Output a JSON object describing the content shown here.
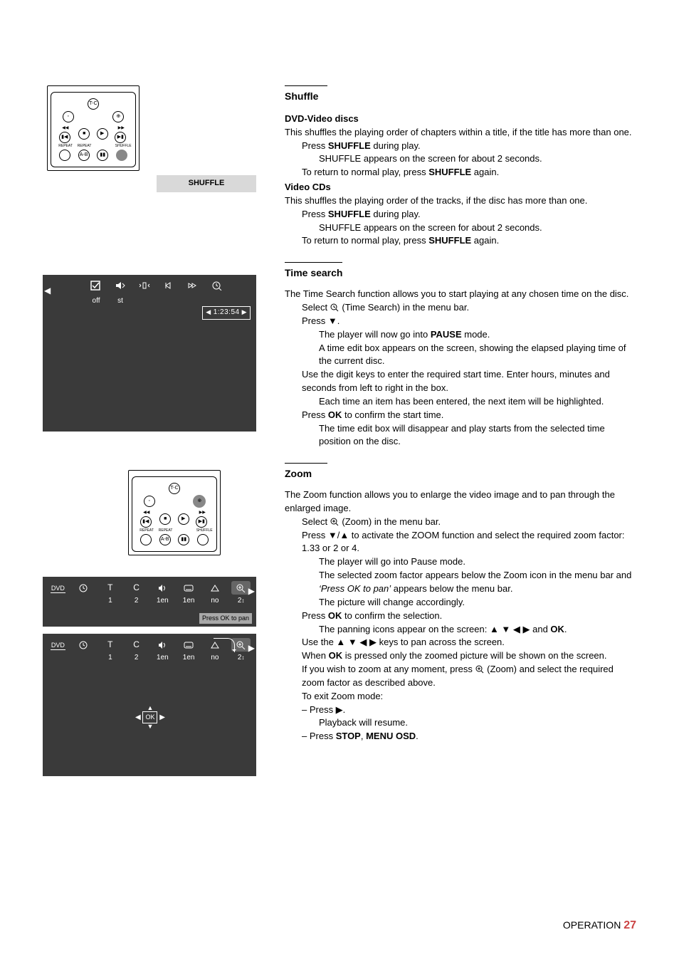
{
  "sections": {
    "shuffle": {
      "title": "Shuffle",
      "button_label": "SHUFFLE",
      "dvd": {
        "heading": "DVD-Video discs",
        "intro_a": "This shuffles the playing order of chapters within a title, if the title has more than one.",
        "step1_a": "Press ",
        "step1_b": "SHUFFLE",
        "step1_c": " during play.",
        "note1": "SHUFFLE appears on the screen for about 2 seconds.",
        "step2_a": "To return to normal play, press ",
        "step2_b": "SHUFFLE",
        "step2_c": " again."
      },
      "vcd": {
        "heading": "Video CDs",
        "intro": "This shuffles the playing order of the tracks, if the disc has more than one.",
        "step1_a": "Press ",
        "step1_b": "SHUFFLE",
        "step1_c": " during play.",
        "note1": "SHUFFLE appears on the screen for about 2 seconds.",
        "step2_a": "To return to normal play, press ",
        "step2_b": "SHUFFLE",
        "step2_c": " again."
      }
    },
    "time": {
      "title": "Time search",
      "intro": "The Time Search function allows you to start playing at any chosen time on the disc.",
      "step1": "Select      (Time Search) in the menu bar.",
      "step2": "Press ▼.",
      "note1_a": "The player will now go into ",
      "note1_b": "PAUSE",
      "note1_c": " mode.",
      "note2": "A time edit box appears on the screen, showing the elapsed playing time of the current disc.",
      "step3": "Use the digit keys to enter the required start time. Enter hours, minutes and seconds from left to right in the box.",
      "note3": "Each time an item has been entered, the next item will be highlighted.",
      "step4_a": "Press ",
      "step4_b": "OK",
      "step4_c": " to confirm the start time.",
      "note4": "The time edit box will disappear and play starts from the selected time position on the disc.",
      "screen": {
        "labels": [
          "off",
          "st"
        ],
        "timecode": "1:23:54"
      }
    },
    "zoom": {
      "title": "Zoom",
      "intro": "The Zoom function allows you to enlarge the video image and to pan through the enlarged image.",
      "step1": "Select      (Zoom) in the menu bar.",
      "step2": "Press ▼/▲ to activate the ZOOM function and select the required zoom factor: 1.33 or 2 or 4.",
      "note1": "The player will go into Pause mode.",
      "note2_a": "The selected zoom factor appears below the Zoom icon in the menu bar and ",
      "note2_i": "‘Press OK to pan’",
      "note2_b": " appears below the menu bar.",
      "note3": "The picture will change accordingly.",
      "step3_a": "Press ",
      "step3_b": "OK",
      "step3_c": " to confirm the selection.",
      "note4_a": "The panning icons appear on the screen: ▲ ▼ ◀ ▶ and ",
      "note4_b": "OK",
      "note4_c": ".",
      "step4": "Use the ▲ ▼ ◀ ▶ keys to pan across the screen.",
      "step5_a": "When ",
      "step5_b": "OK",
      "step5_c": " is pressed only the zoomed picture will be shown on the screen.",
      "step6": "If you wish to zoom at any moment, press      (Zoom) and select the required zoom factor as described above.",
      "exit_head": "To exit Zoom mode:",
      "exit1": "– Press ▶.",
      "exit1_note": "Playback will resume.",
      "exit2_a": "– Press ",
      "exit2_b": "STOP",
      "exit2_c": ", ",
      "exit2_d": "MENU OSD",
      "exit2_e": ".",
      "screen1": {
        "dvd": "DVD",
        "row_top": [
          "T",
          "C"
        ],
        "row_vals": [
          "1",
          "2",
          "1en",
          "1en",
          "no",
          "2"
        ],
        "press_ok": "Press OK to pan"
      },
      "screen2": {
        "dvd": "DVD",
        "row_vals": [
          "1",
          "2",
          "1en",
          "1en",
          "no",
          "2"
        ],
        "ok": "OK"
      }
    }
  },
  "footer": {
    "label": "OPERATION",
    "page": "27"
  }
}
